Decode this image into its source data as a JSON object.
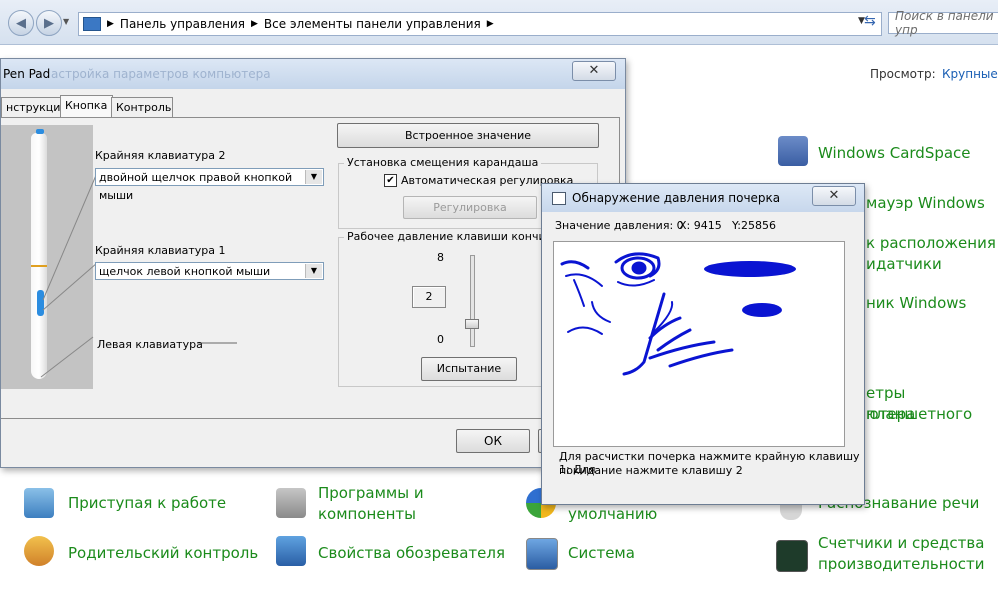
{
  "explorer": {
    "breadcrumb": [
      "Панель управления",
      "Все элементы панели управления"
    ],
    "search_placeholder": "Поиск в панели упр",
    "view_label": "Просмотр:",
    "view_value": "Крупные з",
    "right_items": [
      "Windows CardSpace",
      "мауэр Windows",
      "к расположения и",
      "датчики",
      "ник Windows",
      "етры планшетного",
      "ютера",
      "Распознавание речи",
      "Счетчики и средства",
      "производительности"
    ],
    "bottom_items": {
      "getting_started": "Приступая к работе",
      "programs_line1": "Программы и",
      "programs_line2": "компоненты",
      "defaults": "умолчанию",
      "parental": "Родительский контроль",
      "browser": "Свойства обозревателя",
      "system": "Система"
    }
  },
  "pen_pad": {
    "title": "Pen Pad",
    "subtitle": "астройка параметров компьютера",
    "tabs": [
      "нструкция",
      "Кнопка",
      "Контроль"
    ],
    "upper_key_label": "Крайняя клавиатура 2",
    "upper_key_value": "двойной щелчок правой кнопкой мыши",
    "lower_key_label": "Крайняя клавиатура 1",
    "lower_key_value": "щелчок левой кнопкой мыши",
    "left_key_label": "Левая клавиатура",
    "default_button": "Встроенное значение",
    "offset_group": "Установка смещения карандаша",
    "auto_adjust": "Автоматическая регулировка",
    "adjust_button": "Регулировка",
    "pressure_group": "Рабочее давление клавиши кончика к",
    "slider_max": "8",
    "slider_value": "2",
    "slider_min": "0",
    "slider_level": 0.25,
    "test_button": "Испытание",
    "ok_button": "ОК"
  },
  "pressure_window": {
    "title": "Обнаружение давления почерка",
    "pressure_label": "Значение давления: 0",
    "x_label": "X: 9415",
    "y_label": "Y:25856",
    "hint_line1": "Для расчистки почерка нажмите крайную клавишу 1; Для",
    "hint_line2": "покидание нажмите клавишу 2",
    "ink_color": "#0a14d2"
  },
  "colors": {
    "link_green": "#1b8b1b",
    "link_blue": "#1a5fb4"
  }
}
